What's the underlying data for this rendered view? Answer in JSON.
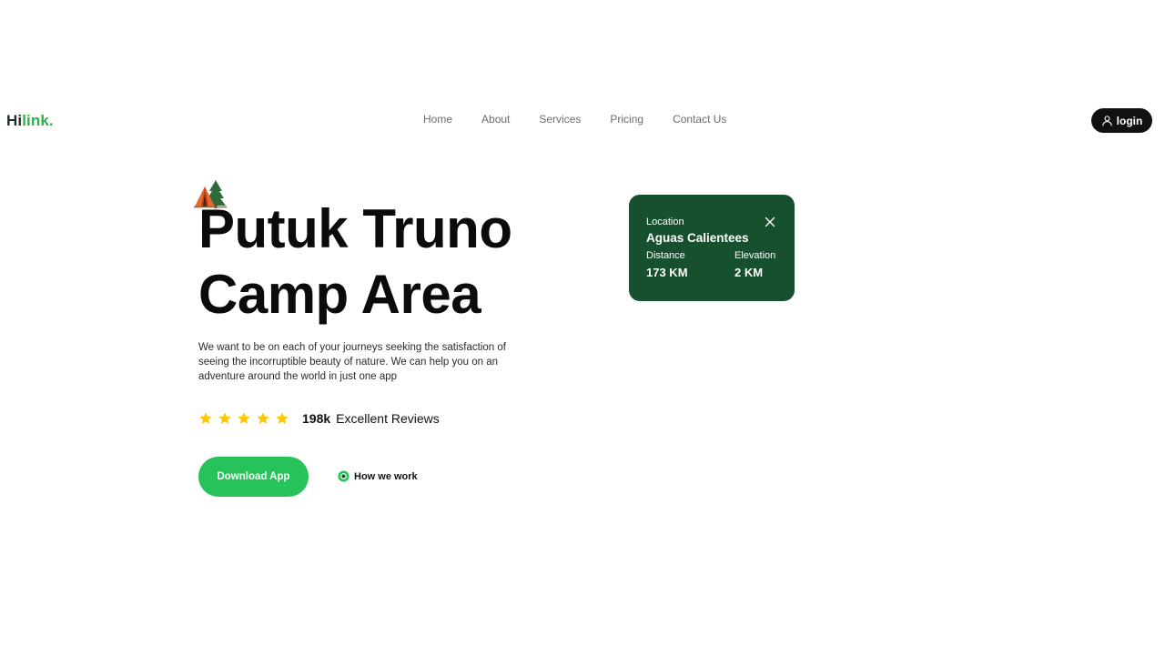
{
  "brand": {
    "prefix": "Hi",
    "suffix": "link."
  },
  "nav": {
    "items": [
      {
        "label": "Home"
      },
      {
        "label": "About"
      },
      {
        "label": "Services"
      },
      {
        "label": "Pricing"
      },
      {
        "label": "Contact Us"
      }
    ],
    "login_label": "login"
  },
  "hero": {
    "icon": "camp-tent-icon",
    "title_line1": "Putuk Truno",
    "title_line2": "Camp Area",
    "description": "We want to be on each of your journeys seeking the satisfaction of seeing the incorruptible beauty of nature. We can help you on an adventure around the world in just one app",
    "rating": {
      "stars": 5,
      "count": "198k",
      "label": "Excellent Reviews"
    },
    "download_label": "Download App",
    "how_label": "How we work"
  },
  "location_card": {
    "location_label": "Location",
    "location_name": "Aguas Calientees",
    "distance_label": "Distance",
    "distance_value": "173 KM",
    "elevation_label": "Elevation",
    "elevation_value": "2 KM"
  },
  "colors": {
    "accent_green": "#27c35a",
    "brand_green": "#2bb24c",
    "card_green": "#17502f",
    "star_yellow": "#fec601",
    "dark": "#111111"
  }
}
